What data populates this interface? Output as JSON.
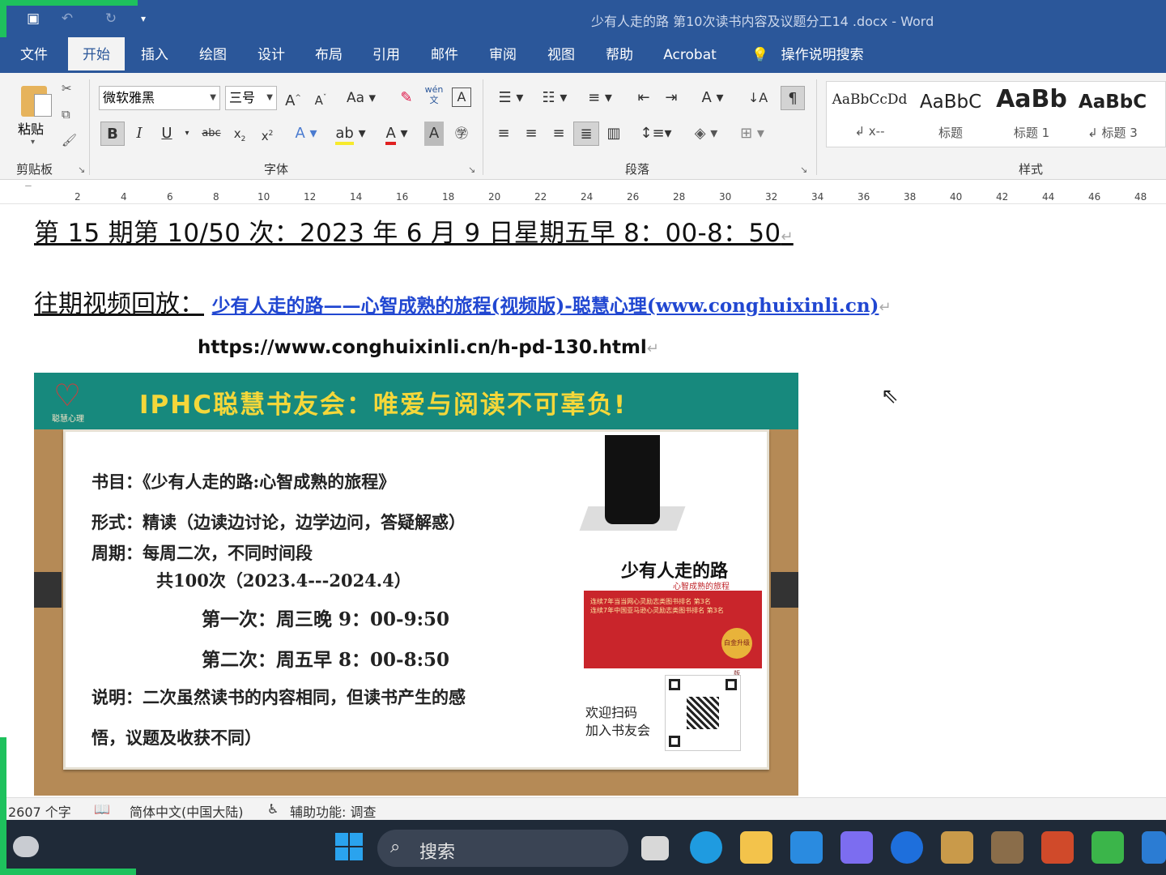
{
  "window": {
    "title": "少有人走的路 第10次读书内容及议题分工14 .docx  -  Word"
  },
  "tabs": [
    {
      "label": "文件"
    },
    {
      "label": "开始"
    },
    {
      "label": "插入"
    },
    {
      "label": "绘图"
    },
    {
      "label": "设计"
    },
    {
      "label": "布局"
    },
    {
      "label": "引用"
    },
    {
      "label": "邮件"
    },
    {
      "label": "审阅"
    },
    {
      "label": "视图"
    },
    {
      "label": "帮助"
    },
    {
      "label": "Acrobat"
    }
  ],
  "active_tab": "开始",
  "tell_me": "操作说明搜索",
  "ribbon": {
    "clipboard": {
      "paste_label": "粘贴",
      "group_label": "剪贴板"
    },
    "font": {
      "font_name": "微软雅黑",
      "font_size": "三号",
      "group_label": "字体",
      "phonetic": "wén\n文"
    },
    "paragraph": {
      "group_label": "段落"
    },
    "styles": {
      "group_label": "样式",
      "items": [
        {
          "sample": "AaBbCcDd",
          "name": "↲ x--"
        },
        {
          "sample": "AaBbC",
          "name": "标题"
        },
        {
          "sample": "AaBb",
          "name": "标题 1"
        },
        {
          "sample": "AaBbC",
          "name": "↲ 标题 3"
        }
      ]
    }
  },
  "ruler": [
    "2",
    "4",
    "6",
    "8",
    "10",
    "12",
    "14",
    "16",
    "18",
    "20",
    "22",
    "24",
    "26",
    "28",
    "30",
    "32",
    "34",
    "36",
    "38",
    "40",
    "42",
    "44",
    "46",
    "48"
  ],
  "document": {
    "line1": "第 15 期第 10/50 次：2023 年 6 月 9 日星期五早 8：00-8：50",
    "line2_label": "往期视频回放：",
    "line2_link": "少有人走的路——心智成熟的旅程(视频版)-聪慧心理(www.conghuixinli.cn)",
    "line3": "https://www.conghuixinli.cn/h-pd-130.html",
    "para_mark": "↵"
  },
  "poster": {
    "logo_text": "聪慧心理",
    "title": "IPHC聪慧书友会：唯爱与阅读不可辜负!",
    "lines": [
      "书目：《少有人走的路:心智成熟的旅程》",
      "形式：精读（边读边讨论，边学边问，答疑解惑）",
      "周期：每周二次，不同时间段",
      "共100次（2023.4---2024.4）",
      "第一次：周三晚 9：00-9:50",
      "第二次：周五早 8：00-8:50",
      "说明：二次虽然读书的内容相同，但读书产生的感",
      "悟，议题及收获不同）"
    ],
    "book_title": "少有人走的路",
    "book_subtitle": "心智成熟的旅程",
    "book_red_text": "连续7年当当网心灵励志类图书排名 第3名\n连续7年中国亚马逊心灵励志类图书排名 第3名",
    "book_badge": "白金升级版",
    "scan_text": "欢迎扫码\n加入书友会"
  },
  "status": {
    "word_count": "2607 个字",
    "language": "简体中文(中国大陆)",
    "accessibility": "辅助功能: 调查"
  },
  "taskbar": {
    "search_placeholder": "搜索"
  }
}
